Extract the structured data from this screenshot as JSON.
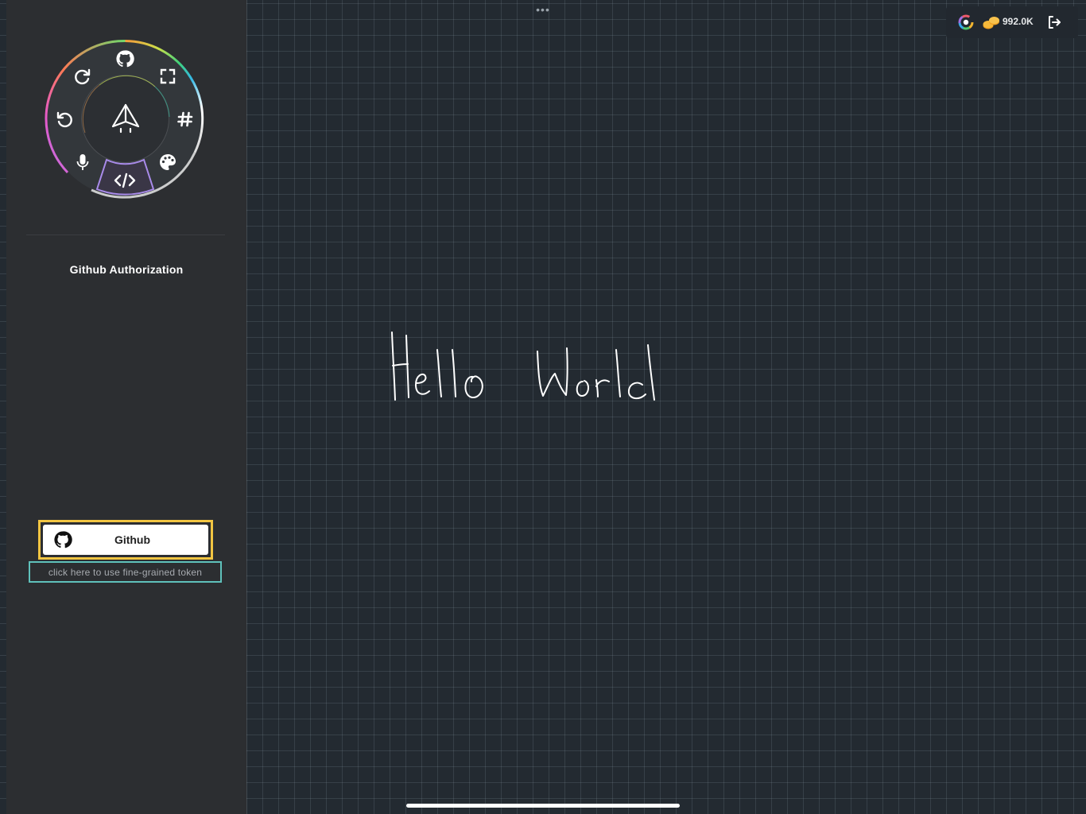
{
  "top_bar": {
    "more_menu_label": "•••",
    "coin_value": "992.0K",
    "icons": [
      "color-wheel-icon",
      "coins-icon",
      "logout-icon"
    ]
  },
  "radial_menu": {
    "items": [
      "github-icon",
      "fullscreen-icon",
      "hashtag-icon",
      "palette-icon",
      "code-icon",
      "microphone-icon",
      "undo-icon",
      "redo-icon"
    ],
    "center_icon": "paper-plane-icon",
    "active_item": "code-icon"
  },
  "sidebar": {
    "title": "Github Authorization",
    "github_button_label": "Github",
    "token_link_label": "click here to use fine-grained token"
  },
  "canvas": {
    "handwritten_text": "Hello World"
  },
  "colors": {
    "background": "#232a31",
    "sidebar": "#2c2e31",
    "highlight_yellow": "#f2c542",
    "highlight_teal": "#5fc1bb",
    "active_purple": "#a98bea"
  }
}
